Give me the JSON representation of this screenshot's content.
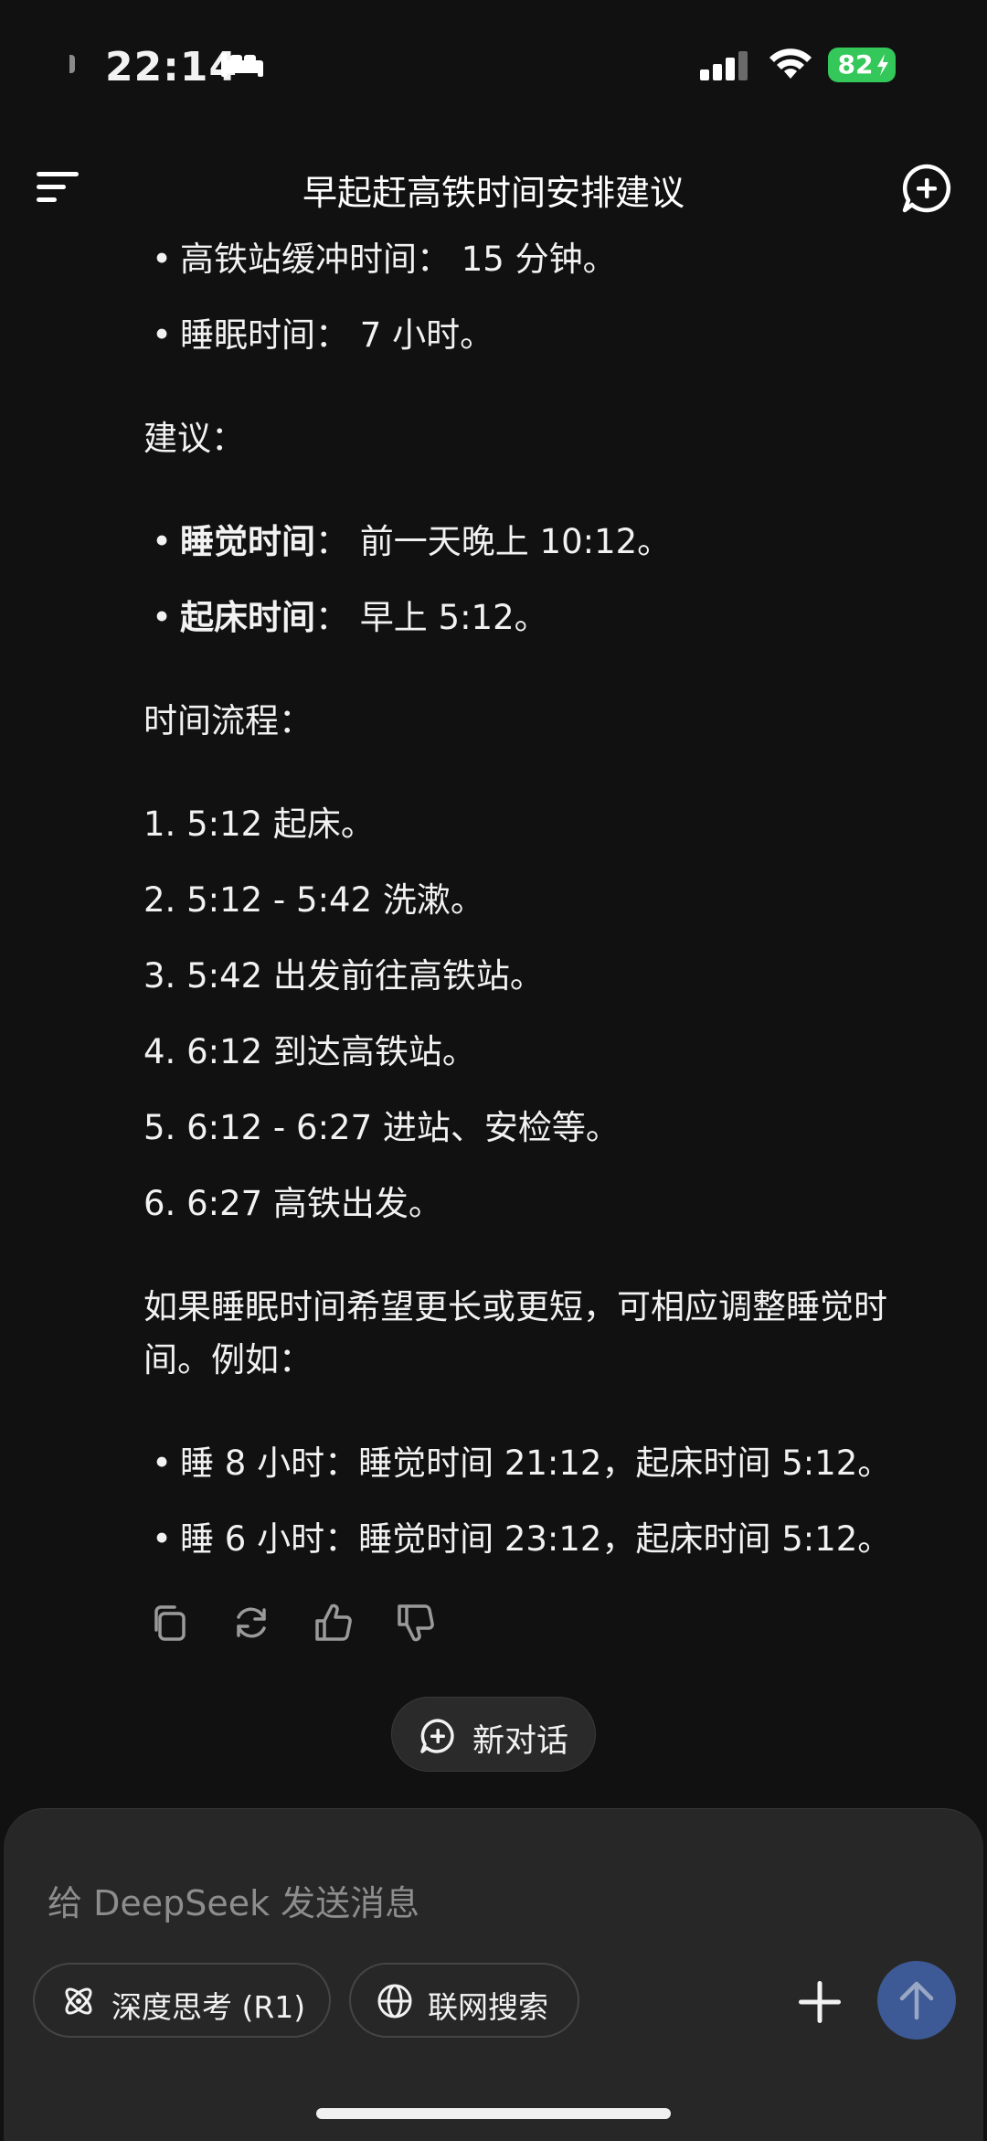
{
  "status_bar": {
    "time": "22:14",
    "battery": "82"
  },
  "header": {
    "title": "早起赶高铁时间安排建议"
  },
  "content": {
    "bullets_top": [
      {
        "text": "高铁站缓冲时间：  15 分钟。"
      },
      {
        "text": "睡眠时间：  7 小时。"
      }
    ],
    "suggest_heading": "建议：",
    "suggest_items": [
      {
        "label": "睡觉时间",
        "value": "：  前一天晚上 10:12。"
      },
      {
        "label": "起床时间",
        "value": "：  早上 5:12。"
      }
    ],
    "flow_heading": "时间流程：",
    "flow_items": [
      "1. 5:12 起床。",
      "2. 5:12 - 5:42 洗漱。",
      "3. 5:42 出发前往高铁站。",
      "4. 6:12 到达高铁站。",
      "5. 6:12 - 6:27 进站、安检等。",
      "6. 6:27 高铁出发。"
    ],
    "paragraph": "如果睡眠时间希望更长或更短，可相应调整睡觉时间。例如：",
    "examples": [
      "睡 8 小时：睡觉时间 21:12，起床时间 5:12。",
      "睡 6 小时：睡觉时间 23:12，起床时间 5:12。"
    ]
  },
  "actions": [
    "copy-icon",
    "regenerate-icon",
    "thumbs-up-icon",
    "thumbs-down-icon"
  ],
  "new_chat": {
    "label": "新对话"
  },
  "composer": {
    "placeholder": "给 DeepSeek 发送消息",
    "deep_think_label": "深度思考 (R1)",
    "web_search_label": "联网搜索"
  },
  "colors": {
    "background": "#111111",
    "composer": "#272727",
    "send": "#3d5a96",
    "battery": "#34c759"
  }
}
